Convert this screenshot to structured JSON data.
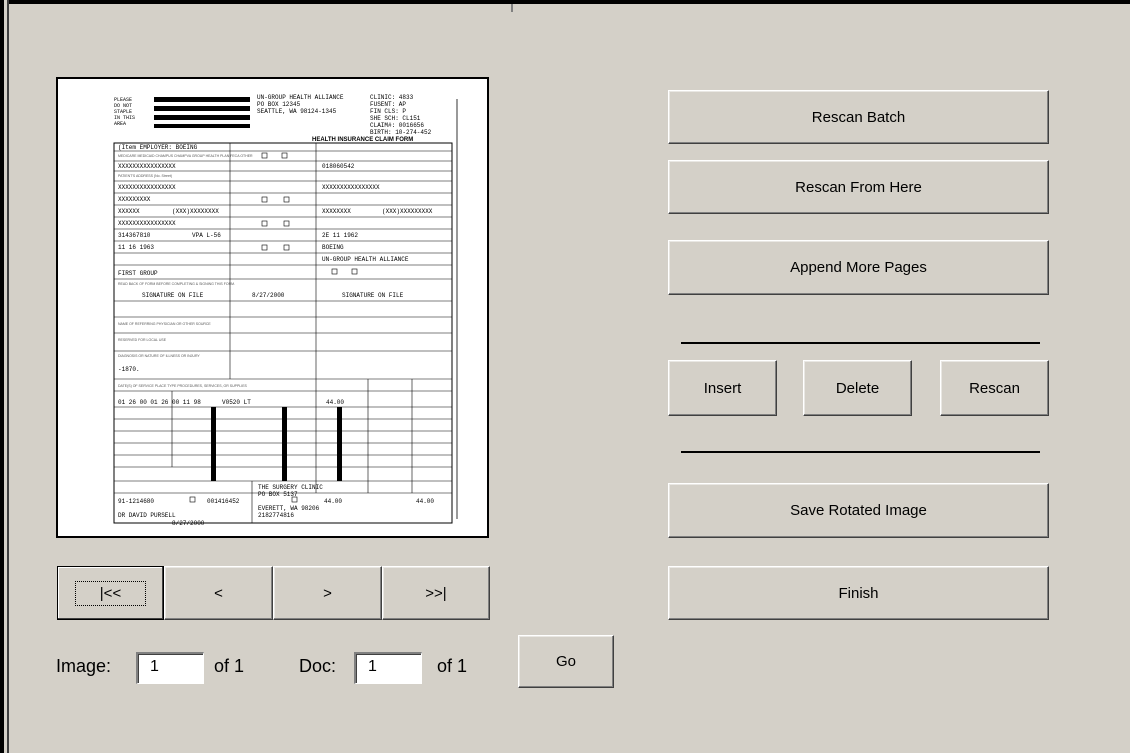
{
  "window": {
    "title": ""
  },
  "right_panel": {
    "rescan_batch": "Rescan Batch",
    "rescan_from_here": "Rescan From Here",
    "append_more_pages": "Append More Pages",
    "insert": "Insert",
    "delete": "Delete",
    "rescan": "Rescan",
    "save_rotated_image": "Save Rotated Image",
    "finish": "Finish"
  },
  "navigation": {
    "first": "|<<",
    "prev": "<",
    "next": ">",
    "last": ">>|"
  },
  "image_counter": {
    "label": "Image:",
    "value": "1",
    "of": "of 1"
  },
  "doc_counter": {
    "label": "Doc:",
    "value": "1",
    "of": "of 1"
  },
  "go_button": "Go",
  "preview": {
    "form_title": "HEALTH INSURANCE CLAIM FORM",
    "payer_lines": [
      "UN-GROUP HEALTH ALLIANCE",
      "PO BOX 12345",
      "SEATTLE, WA 98124-1345"
    ],
    "claim_lines": [
      "CLINIC: 4833",
      "FUSENT: AP",
      "FIN CLS: P",
      "SHE SCH: CL151",
      "CLAIM#: 0016656",
      "BIRTH: 10-274-452"
    ],
    "signature_1": "SIGNATURE ON FILE",
    "signature_date": "8/27/2000",
    "signature_2": "SIGNATURE ON FILE",
    "patient_name": "FIRST GROUP",
    "insurer": "UN-GROUP HEALTH ALLIANCE",
    "billing_lines": [
      "THE SURGERY CLINIC",
      "PO BOX 5137",
      "EVERETT, WA 98206",
      "2182774816"
    ],
    "physician": "DR DAVID PURSELL",
    "physician_date": "8/27/2000",
    "tax_id": "91-1214680",
    "account": "001416452",
    "total_charge": "44.00",
    "balance": "44.00"
  }
}
